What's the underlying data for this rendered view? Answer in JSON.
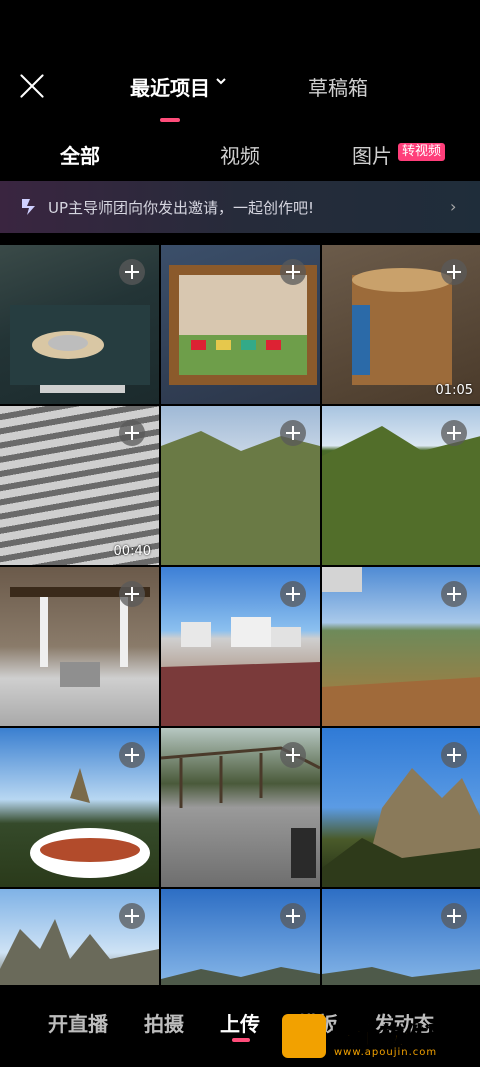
{
  "header": {
    "recent": "最近项目",
    "draft": "草稿箱"
  },
  "filters": {
    "all": "全部",
    "video": "视频",
    "photo": "图片",
    "badge": "转视频"
  },
  "banner": {
    "text": "UP主导师团向你发出邀请，一起创作吧!",
    "arrow": "›"
  },
  "grid": {
    "durations": {
      "t3": "01:05",
      "t4": "00:40"
    }
  },
  "bottom": {
    "live": "开直播",
    "shoot": "拍摄",
    "upload": "上传",
    "template": "模板",
    "post": "发动态"
  },
  "watermark": {
    "text": "欧金软件园",
    "sub": "www.apoujin.com"
  }
}
